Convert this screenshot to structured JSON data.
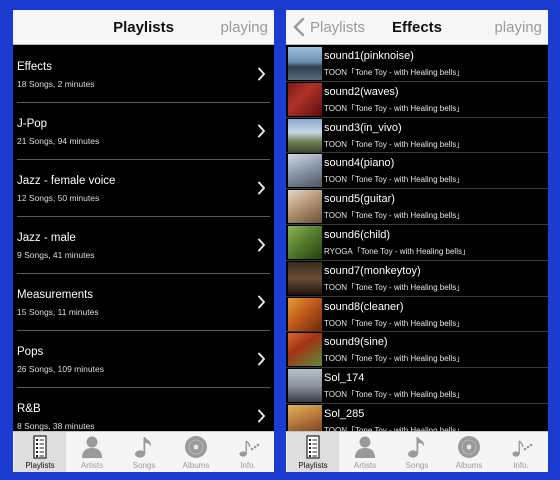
{
  "left": {
    "title": "Playlists",
    "right_label": "playing",
    "playlists": [
      {
        "name": "Effects",
        "meta": "18 Songs,  2 minutes"
      },
      {
        "name": "J-Pop",
        "meta": "21 Songs,  94 minutes"
      },
      {
        "name": "Jazz - female voice",
        "meta": "12 Songs,  50 minutes"
      },
      {
        "name": "Jazz - male",
        "meta": "9 Songs,  41 minutes"
      },
      {
        "name": "Measurements",
        "meta": "15 Songs,  11 minutes"
      },
      {
        "name": "Pops",
        "meta": "26 Songs,  109 minutes"
      },
      {
        "name": "R&B",
        "meta": "8 Songs,  38 minutes"
      }
    ]
  },
  "right": {
    "back_label": "Playlists",
    "title": "Effects",
    "right_label": "playing",
    "tracks": [
      {
        "title": "sound1(pinknoise)",
        "artist": "TOON「Tone Toy - with Healing bells」",
        "thumb": "thumb-a"
      },
      {
        "title": "sound2(waves)",
        "artist": "TOON「Tone Toy - with Healing bells」",
        "thumb": "thumb-b"
      },
      {
        "title": "sound3(in_vivo)",
        "artist": "TOON「Tone Toy - with Healing bells」",
        "thumb": "thumb-c"
      },
      {
        "title": "sound4(piano)",
        "artist": "TOON「Tone Toy - with Healing bells」",
        "thumb": "thumb-d"
      },
      {
        "title": "sound5(guitar)",
        "artist": "TOON「Tone Toy - with Healing bells」",
        "thumb": "thumb-e"
      },
      {
        "title": "sound6(child)",
        "artist": "RYOGA「Tone Toy - with Healing bells」",
        "thumb": "thumb-f"
      },
      {
        "title": "sound7(monkeytoy)",
        "artist": "TOON「Tone Toy - with Healing bells」",
        "thumb": "thumb-g"
      },
      {
        "title": "sound8(cleaner)",
        "artist": "TOON「Tone Toy - with Healing bells」",
        "thumb": "thumb-h"
      },
      {
        "title": "sound9(sine)",
        "artist": "TOON「Tone Toy - with Healing bells」",
        "thumb": "thumb-i"
      },
      {
        "title": "Sol_174",
        "artist": "TOON「Tone Toy - with Healing bells」",
        "thumb": "thumb-j"
      },
      {
        "title": "Sol_285",
        "artist": "TOON「Tone Toy - with Healing bells」",
        "thumb": "thumb-k"
      }
    ]
  },
  "tabbar": {
    "tabs": [
      {
        "label": "Playlists",
        "icon": "playlist-icon",
        "active": true
      },
      {
        "label": "Artists",
        "icon": "person-icon",
        "active": false
      },
      {
        "label": "Songs",
        "icon": "music-note-icon",
        "active": false
      },
      {
        "label": "Albums",
        "icon": "disc-icon",
        "active": false
      },
      {
        "label": "Info.",
        "icon": "info-notes-icon",
        "active": false
      }
    ]
  },
  "colors": {
    "background": "#1c3bd0",
    "screen": "#000000",
    "navbar": "#f7f7f7",
    "inactive": "#9a9a9a"
  }
}
